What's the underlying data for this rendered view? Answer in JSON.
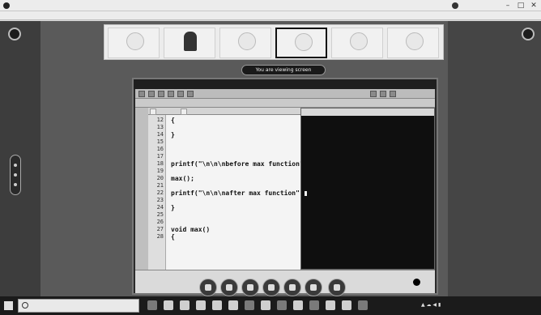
{
  "window": {
    "title": "",
    "user_name": "",
    "minimize": "–",
    "maximize": "□",
    "close": "✕"
  },
  "menu": [
    "",
    "",
    "",
    "",
    "",
    "",
    "",
    ""
  ],
  "participants": [
    {
      "name": "",
      "avatar": "circle-icon"
    },
    {
      "name": "",
      "avatar": "photo"
    },
    {
      "name": "",
      "avatar": "circle-icon"
    },
    {
      "name": "",
      "avatar": "circle-icon",
      "active": true
    },
    {
      "name": "",
      "avatar": "circle-icon"
    },
    {
      "name": "",
      "avatar": "circle-icon"
    }
  ],
  "share_banner": "You are viewing screen",
  "ide": {
    "tabs": [
      "",
      ""
    ],
    "lines": [
      {
        "n": "12",
        "code": "{"
      },
      {
        "n": "13",
        "code": ""
      },
      {
        "n": "14",
        "code": "}"
      },
      {
        "n": "15",
        "code": ""
      },
      {
        "n": "16",
        "code": ""
      },
      {
        "n": "17",
        "code": ""
      },
      {
        "n": "18",
        "code": "printf(\"\\n\\n\\nbefore max function\""
      },
      {
        "n": "19",
        "code": ""
      },
      {
        "n": "20",
        "code": "max();"
      },
      {
        "n": "21",
        "code": ""
      },
      {
        "n": "22",
        "code": "printf(\"\\n\\n\\nafter max function\""
      },
      {
        "n": "23",
        "code": ""
      },
      {
        "n": "24",
        "code": "}"
      },
      {
        "n": "25",
        "code": ""
      },
      {
        "n": "26",
        "code": ""
      },
      {
        "n": "27",
        "code": "void max()"
      },
      {
        "n": "28",
        "code": "{"
      }
    ],
    "comments": {
      "line20": "",
      "line26": ""
    },
    "console_title": "",
    "console_lines": [
      "",
      "",
      "",
      "",
      "",
      "",
      "",
      ""
    ],
    "bottom_tabs": [
      "",
      "",
      "",
      "",
      "",
      ""
    ],
    "bottom_rows": [
      "",
      ""
    ]
  },
  "taskbar": {
    "search_placeholder": "",
    "tray_lang": "",
    "time": "",
    "date": ""
  },
  "colors": {
    "meeting_bg": "#5a5a5a",
    "console_bg": "#0f0f0f",
    "taskbar_bg": "#1b1b1b"
  }
}
